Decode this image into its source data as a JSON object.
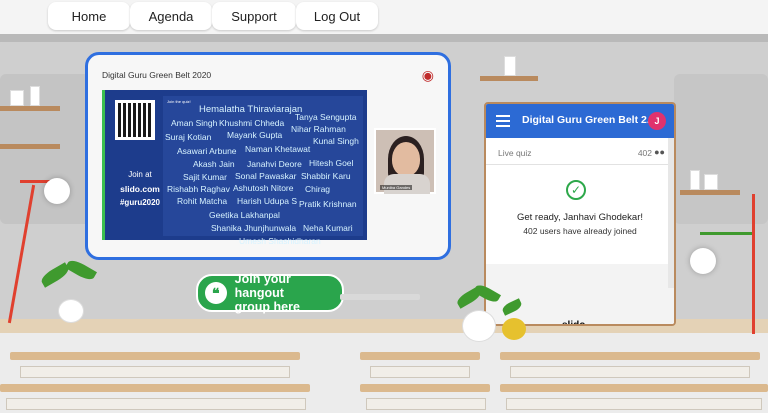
{
  "nav": {
    "home": "Home",
    "agenda": "Agenda",
    "support": "Support",
    "logout": "Log Out"
  },
  "slide": {
    "title": "Digital Guru Green Belt 2020",
    "join_at": "Join at",
    "site": "slido.com",
    "code": "#guru2020",
    "cloud_header": "Join the quiz!",
    "words": [
      "Hemalatha Thiraviarajan",
      "Tanya Sengupta",
      "Aman Singh",
      "Khushmi Chheda",
      "Nihar Rahman",
      "Suraj Kotian",
      "Mayank Gupta",
      "Kunal Singh",
      "Asawari Arbune",
      "Naman Khetawat",
      "Akash Jain",
      "Janahvi Deore",
      "Hitesh Goel",
      "Sajit Kumar",
      "Sonal Pawaskar",
      "Shabbir Karu",
      "Rishabh Raghav",
      "Ashutosh Nitore",
      "Chirag",
      "Rohit Matcha",
      "Harish Udupa S",
      "Pratik Krishnan",
      "Geetika Lakhanpal",
      "Shanika Jhunjhunwala",
      "Neha Kumari",
      "Umesh Shashidharan"
    ],
    "video_label": "Muniba Gandes"
  },
  "hangout": {
    "line1": "Join your hangout",
    "line2": "group here"
  },
  "slido": {
    "title": "Digital Guru Green Belt 2...",
    "avatar_initial": "J",
    "live_quiz": "Live quiz",
    "count": "402",
    "ready": "Get ready, Janhavi Ghodekar!",
    "joined": "402 users have already joined",
    "brand": "slido"
  },
  "colors": {
    "accent": "#2f6fe0",
    "slido_header": "#2c6ad4",
    "hangout": "#2aa54c",
    "avatar": "#e0326d"
  }
}
